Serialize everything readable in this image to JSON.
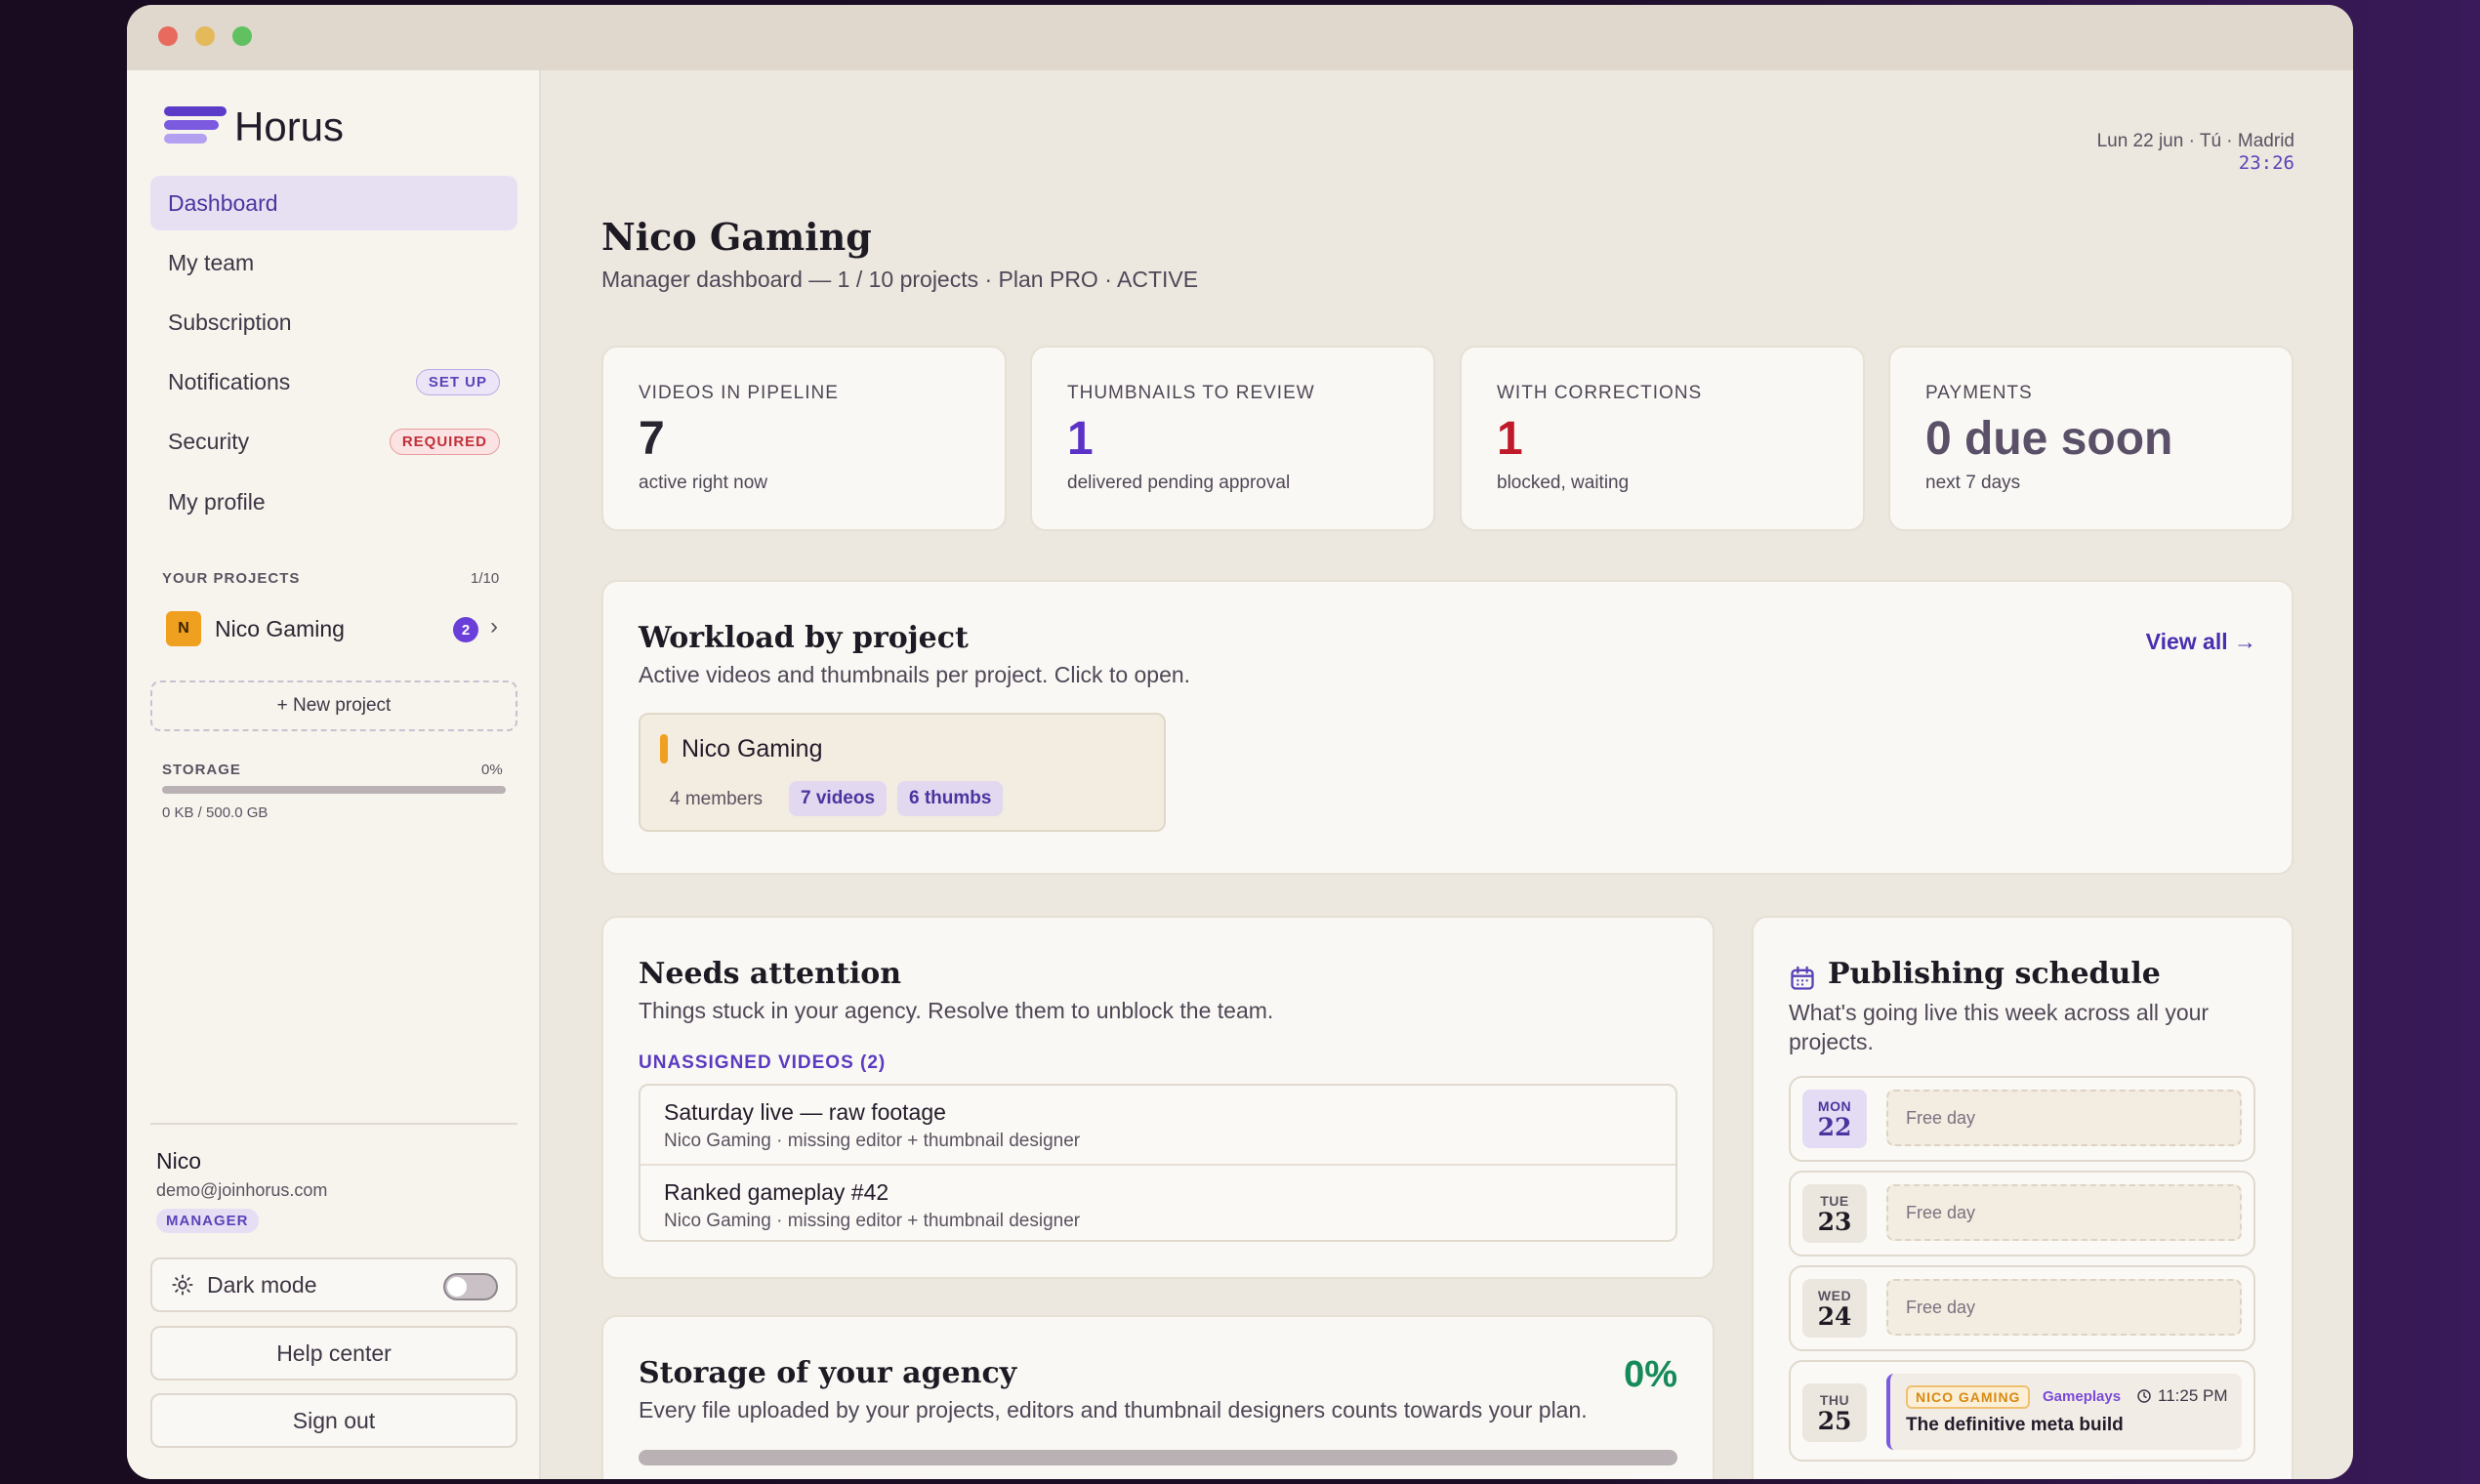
{
  "window": {
    "traffic_lights": [
      "close",
      "minimize",
      "zoom"
    ]
  },
  "brand": {
    "name": "Horus"
  },
  "sidebar": {
    "nav": [
      {
        "label": "Dashboard"
      },
      {
        "label": "My team"
      },
      {
        "label": "Subscription"
      },
      {
        "label": "Notifications",
        "badge": "SET UP"
      },
      {
        "label": "Security",
        "badge": "REQUIRED"
      },
      {
        "label": "My profile"
      }
    ],
    "projects_label": "YOUR PROJECTS",
    "projects_count": "1/10",
    "projects": [
      {
        "initial": "N",
        "name": "Nico Gaming",
        "count": "2",
        "chevron": "›"
      }
    ],
    "new_project": "+ New project",
    "storage": {
      "label": "STORAGE",
      "percent": "0%",
      "fill_fraction": 0,
      "usage": "0 KB / 500.0 GB"
    },
    "user": {
      "name": "Nico",
      "email": "demo@joinhorus.com",
      "role": "MANAGER"
    },
    "dark_mode": {
      "label": "Dark mode",
      "enabled": false
    },
    "help": "Help center",
    "sign_out": "Sign out"
  },
  "header": {
    "date": "Lun 22 jun · Tú · Madrid",
    "time": "23:26",
    "title": "Nico Gaming",
    "subtitle": "Manager dashboard — 1 / 10 projects · Plan PRO · ACTIVE"
  },
  "stats": [
    {
      "label": "VIDEOS IN PIPELINE",
      "value": "7",
      "caption": "active right now",
      "color": "#2a2330"
    },
    {
      "label": "THUMBNAILS TO REVIEW",
      "value": "1",
      "caption": "delivered pending approval",
      "color": "#5a32c8"
    },
    {
      "label": "WITH CORRECTIONS",
      "value": "1",
      "caption": "blocked, waiting",
      "color": "#c01a2a"
    },
    {
      "label": "PAYMENTS",
      "value": "0 due soon",
      "caption": "next 7 days",
      "color": "#5a5068"
    }
  ],
  "workload": {
    "title": "Workload by project",
    "subtitle": "Active videos and thumbnails per project. Click to open.",
    "view_all": "View all →",
    "projects": [
      {
        "name": "Nico Gaming",
        "members": "4 members",
        "videos": "7 videos",
        "thumbs": "6 thumbs"
      }
    ]
  },
  "attention": {
    "title": "Needs attention",
    "subtitle": "Things stuck in your agency. Resolve them to unblock the team.",
    "section": "UNASSIGNED VIDEOS (2)",
    "items": [
      {
        "title": "Saturday live — raw footage",
        "meta": "Nico Gaming · missing editor + thumbnail designer"
      },
      {
        "title": "Ranked gameplay #42",
        "meta": "Nico Gaming · missing editor + thumbnail designer"
      }
    ]
  },
  "agency_storage": {
    "title": "Storage of your agency",
    "subtitle": "Every file uploaded by your projects, editors and thumbnail designers counts towards your plan.",
    "percent": "0%",
    "fill_fraction": 0
  },
  "schedule": {
    "title": "Publishing schedule",
    "subtitle": "What's going live this week across all your projects.",
    "days": [
      {
        "dow": "MON",
        "num": "22",
        "free": "Free day",
        "today": true
      },
      {
        "dow": "TUE",
        "num": "23",
        "free": "Free day"
      },
      {
        "dow": "WED",
        "num": "24",
        "free": "Free day"
      },
      {
        "dow": "THU",
        "num": "25",
        "event": {
          "project": "NICO GAMING",
          "category": "Gameplays",
          "time": "11:25 PM",
          "title": "The definitive meta build"
        }
      }
    ]
  }
}
